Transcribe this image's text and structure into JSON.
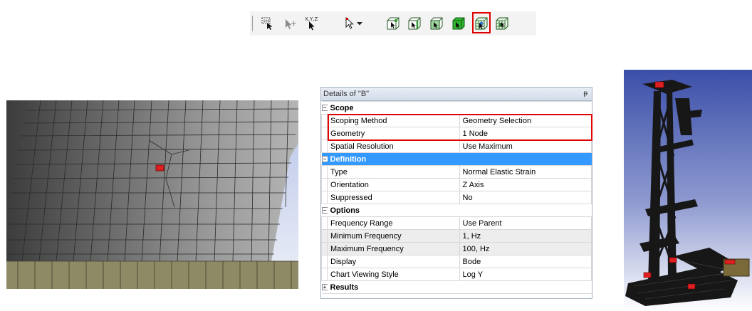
{
  "toolbar": {
    "buttons": [
      {
        "icon": "box-select-icon",
        "highlighted": false
      },
      {
        "icon": "select-point-icon",
        "highlighted": false
      },
      {
        "icon": "xyz-coordinate-select-icon",
        "label": "X,Y,Z",
        "highlighted": false
      },
      {
        "icon": "select-mode-dropdown-icon",
        "highlighted": false
      },
      {
        "icon": "select-vertex-icon",
        "highlighted": false
      },
      {
        "icon": "select-edge-icon",
        "highlighted": false
      },
      {
        "icon": "select-face-icon",
        "highlighted": false
      },
      {
        "icon": "select-body-icon",
        "highlighted": false
      },
      {
        "icon": "select-mesh-node-icon",
        "highlighted": true
      },
      {
        "icon": "select-mesh-element-icon",
        "highlighted": false
      }
    ],
    "highlight_color": "#e00000"
  },
  "details": {
    "title": "Details of \"B\"",
    "pin": "ᵽ",
    "sections": {
      "scope": {
        "label": "Scope",
        "rows": [
          {
            "key": "Scoping Method",
            "value": "Geometry Selection"
          },
          {
            "key": "Geometry",
            "value": "1 Node"
          },
          {
            "key": "Spatial Resolution",
            "value": "Use Maximum"
          }
        ]
      },
      "definition": {
        "label": "Definition",
        "rows": [
          {
            "key": "Type",
            "value": "Normal Elastic Strain"
          },
          {
            "key": "Orientation",
            "value": "Z Axis"
          },
          {
            "key": "Suppressed",
            "value": "No"
          }
        ]
      },
      "options": {
        "label": "Options",
        "rows": [
          {
            "key": "Frequency Range",
            "value": "Use Parent"
          },
          {
            "key": "Minimum Frequency",
            "value": "1, Hz"
          },
          {
            "key": "Maximum Frequency",
            "value": "100, Hz"
          },
          {
            "key": "Display",
            "value": "Bode"
          },
          {
            "key": "Chart Viewing Style",
            "value": "Log Y"
          }
        ]
      },
      "results": {
        "label": "Results"
      }
    },
    "selected_color": "#3399ff"
  }
}
